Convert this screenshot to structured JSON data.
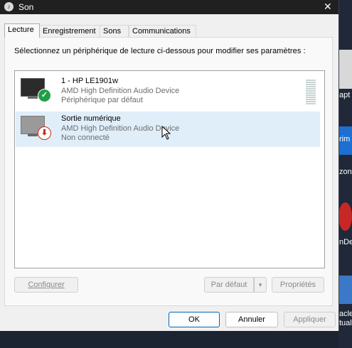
{
  "window": {
    "title": "Son",
    "close_glyph": "✕",
    "icon": "speaker-icon"
  },
  "tabs": [
    {
      "label": "Lecture",
      "active": true
    },
    {
      "label": "Enregistrement",
      "active": false
    },
    {
      "label": "Sons",
      "active": false
    },
    {
      "label": "Communications",
      "active": false
    }
  ],
  "instruction": "Sélectionnez un périphérique de lecture ci-dessous pour modifier ses paramètres :",
  "devices": [
    {
      "name": "1 - HP LE1901w",
      "driver": "AMD High Definition Audio Device",
      "status": "Périphérique par défaut",
      "badge": "check-icon",
      "badge_glyph": "✓",
      "selected": false
    },
    {
      "name": "Sortie numérique",
      "driver": "AMD High Definition Audio Device",
      "status": "Non connecté",
      "badge": "down-arrow-icon",
      "badge_glyph": "⬇",
      "selected": true
    }
  ],
  "buttons": {
    "configure": "Configurer",
    "default": "Par défaut",
    "default_arrow": "▾",
    "properties": "Propriétés",
    "ok": "OK",
    "cancel": "Annuler",
    "apply": "Appliquer"
  },
  "desktop": {
    "labels": [
      "apt",
      "rim vid",
      "zon p fo",
      "nDe",
      "acle tual"
    ]
  },
  "colors": {
    "accent": "#0067c0",
    "selection": "#e0eef9",
    "check": "#1ea044",
    "warning": "#c42b1c"
  }
}
